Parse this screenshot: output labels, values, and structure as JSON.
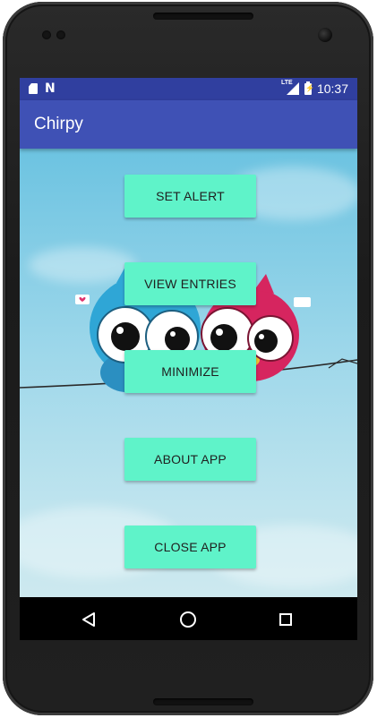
{
  "status_bar": {
    "left_icons": [
      "sd-card-icon",
      "n-notification-icon"
    ],
    "lte_label": "LTE",
    "time": "10:37"
  },
  "app_bar": {
    "title": "Chirpy"
  },
  "buttons": {
    "set_alert": "SET ALERT",
    "view_entries": "VIEW ENTRIES",
    "minimize": "MINIMIZE",
    "about_app": "ABOUT APP",
    "close_app": "CLOSE APP"
  },
  "nav_bar": {
    "icons": [
      "back-icon",
      "home-icon",
      "recents-icon"
    ]
  },
  "colors": {
    "status_bar": "#303f9f",
    "app_bar": "#3f51b5",
    "button": "#5ff3c9"
  }
}
